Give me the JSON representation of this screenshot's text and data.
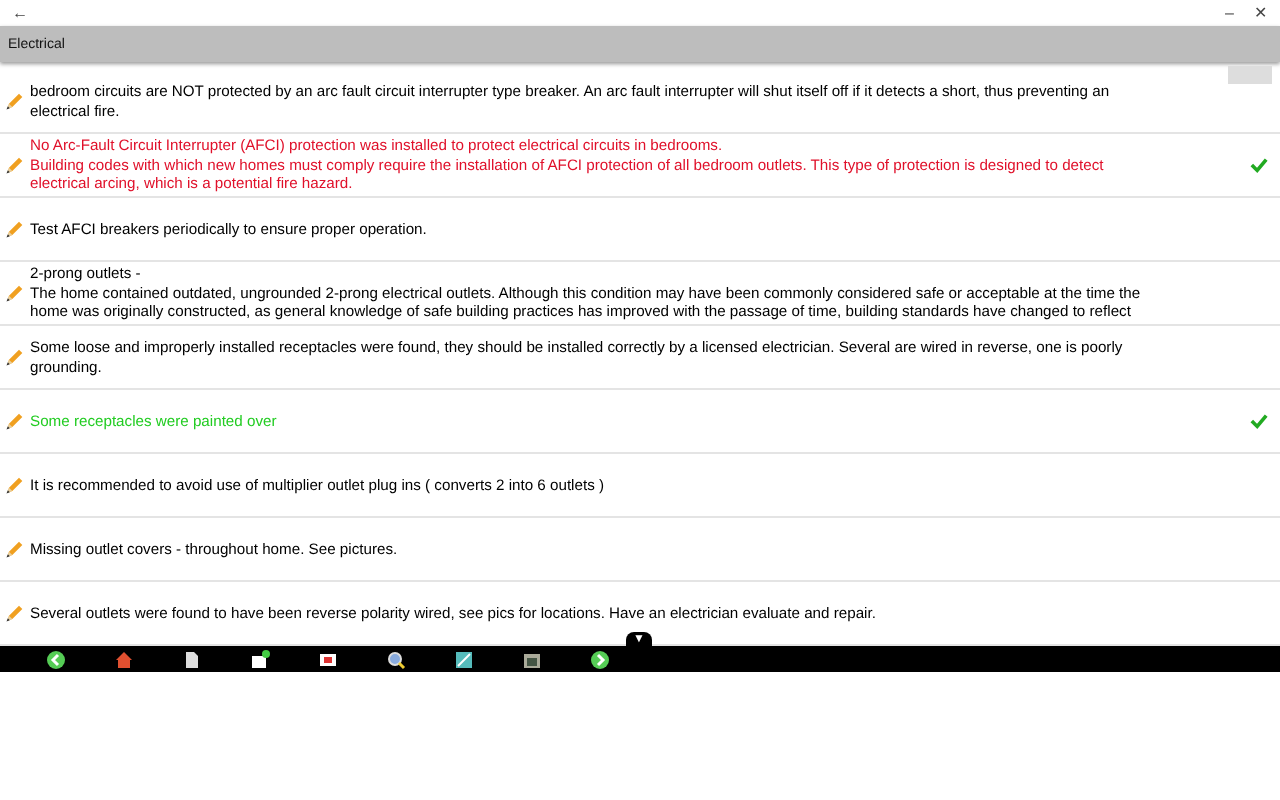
{
  "window": {
    "back": "←",
    "minimize": "–",
    "close": "✕"
  },
  "header": {
    "title": "Electrical"
  },
  "items": [
    {
      "lines": [
        "bedroom circuits are NOT protected by an arc fault circuit interrupter type breaker. An arc fault interrupter will shut itself off if it detects a short, thus preventing an",
        "electrical fire."
      ],
      "color": "#000000",
      "checked": false
    },
    {
      "lines": [
        "No Arc-Fault Circuit Interrupter (AFCI) protection was installed to protect electrical circuits in bedrooms.",
        " Building codes with which new homes must comply require the installation of AFCI protection of all bedroom outlets. This type of protection is designed to detect",
        "electrical arcing, which is a potential fire hazard."
      ],
      "color": "#e0102a",
      "checked": true
    },
    {
      "lines": [
        "Test AFCI breakers periodically to ensure proper operation."
      ],
      "color": "#000000",
      "checked": false
    },
    {
      "lines": [
        "2-prong outlets -",
        "The home contained outdated, ungrounded 2-prong electrical outlets. Although this condition may have been commonly considered safe or acceptable at the time the",
        "home was originally constructed, as general knowledge of safe building practices has improved with the passage of time, building standards have changed to reflect"
      ],
      "color": "#000000",
      "checked": false
    },
    {
      "lines": [
        "Some loose and improperly installed receptacles were found, they should be installed correctly by a licensed electrician. Several are wired in reverse, one is poorly",
        "grounding."
      ],
      "color": "#000000",
      "checked": false
    },
    {
      "lines": [
        "Some receptacles were painted over"
      ],
      "color": "#22cc22",
      "checked": true
    },
    {
      "lines": [
        "It is recommended to avoid use of multiplier outlet plug ins ( converts 2 into 6 outlets )"
      ],
      "color": "#000000",
      "checked": false
    },
    {
      "lines": [
        "Missing outlet covers - throughout home.  See pictures."
      ],
      "color": "#000000",
      "checked": false
    },
    {
      "lines": [
        "Several outlets were found to have been reverse polarity wired, see pics for locations. Have an electrician evaluate and repair."
      ],
      "color": "#000000",
      "checked": false
    }
  ],
  "toolbar": {
    "toggle": "▼",
    "tools": [
      {
        "kind": "back"
      },
      {
        "kind": "home"
      },
      {
        "kind": "doc"
      },
      {
        "kind": "add"
      },
      {
        "kind": "photo"
      },
      {
        "kind": "search"
      },
      {
        "kind": "image"
      },
      {
        "kind": "gallery"
      },
      {
        "kind": "next"
      }
    ]
  }
}
